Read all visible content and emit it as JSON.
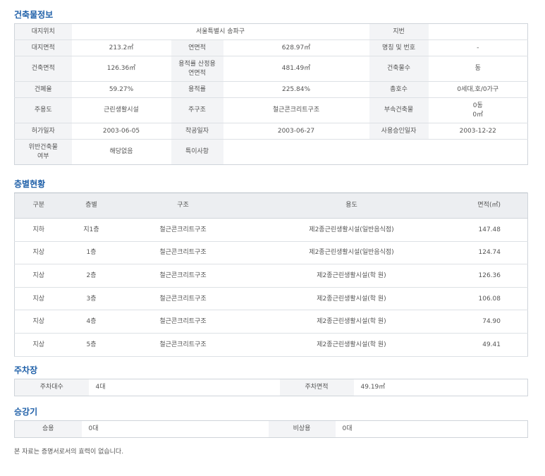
{
  "sections": {
    "building_info": "건축물정보",
    "floors": "층별현황",
    "parking": "주차장",
    "elevator": "승강기"
  },
  "building_info": {
    "rows": [
      [
        {
          "text": "대지위치",
          "type": "label"
        },
        {
          "text": "서울특별시 송파구",
          "type": "value",
          "colspan": 3
        },
        {
          "text": "지번",
          "type": "label"
        },
        {
          "text": "",
          "type": "value"
        }
      ],
      [
        {
          "text": "대지면적",
          "type": "label"
        },
        {
          "text": "213.2㎡",
          "type": "value"
        },
        {
          "text": "연면적",
          "type": "label"
        },
        {
          "text": "628.97㎡",
          "type": "value"
        },
        {
          "text": "명칭 및 번호",
          "type": "label"
        },
        {
          "text": "-",
          "type": "value"
        }
      ],
      [
        {
          "text": "건축면적",
          "type": "label"
        },
        {
          "text": "126.36㎡",
          "type": "value"
        },
        {
          "text": "용적률 산정용\n연면적",
          "type": "label"
        },
        {
          "text": "481.49㎡",
          "type": "value"
        },
        {
          "text": "건축물수",
          "type": "label"
        },
        {
          "text": "동",
          "type": "value"
        }
      ],
      [
        {
          "text": "건폐율",
          "type": "label"
        },
        {
          "text": "59.27%",
          "type": "value"
        },
        {
          "text": "용적률",
          "type": "label"
        },
        {
          "text": "225.84%",
          "type": "value"
        },
        {
          "text": "총호수",
          "type": "label"
        },
        {
          "text": "0세대,호/0가구",
          "type": "value"
        }
      ],
      [
        {
          "text": "주용도",
          "type": "label"
        },
        {
          "text": "근린생활시설",
          "type": "value"
        },
        {
          "text": "주구조",
          "type": "label"
        },
        {
          "text": "철근콘크리트구조",
          "type": "value"
        },
        {
          "text": "부속건축물",
          "type": "label"
        },
        {
          "text": "0동\n0㎡",
          "type": "value"
        }
      ],
      [
        {
          "text": "허가일자",
          "type": "label"
        },
        {
          "text": "2003-06-05",
          "type": "value"
        },
        {
          "text": "착공일자",
          "type": "label"
        },
        {
          "text": "2003-06-27",
          "type": "value"
        },
        {
          "text": "사용승인일자",
          "type": "label"
        },
        {
          "text": "2003-12-22",
          "type": "value"
        }
      ],
      [
        {
          "text": "위반건축물\n여부",
          "type": "label"
        },
        {
          "text": "해당없음",
          "type": "value"
        },
        {
          "text": "특이사항",
          "type": "label"
        },
        {
          "text": "",
          "type": "value",
          "colspan": 3
        }
      ]
    ]
  },
  "floors": {
    "headers": [
      "구분",
      "층별",
      "구조",
      "용도",
      "면적(㎡)"
    ],
    "rows": [
      [
        "지하",
        "지1층",
        "철근콘크리트구조",
        "제2종근린생활시설(일반음식점)",
        "147.48"
      ],
      [
        "지상",
        "1층",
        "철근콘크리트구조",
        "제2종근린생활시설(일반음식점)",
        "124.74"
      ],
      [
        "지상",
        "2층",
        "철근콘크리트구조",
        "제2종근린생활시설(학 원)",
        "126.36"
      ],
      [
        "지상",
        "3층",
        "철근콘크리트구조",
        "제2종근린생활시설(학 원)",
        "106.08"
      ],
      [
        "지상",
        "4층",
        "철근콘크리트구조",
        "제2종근린생활시설(학 원)",
        "74.90"
      ],
      [
        "지상",
        "5층",
        "철근콘크리트구조",
        "제2종근린생활시설(학 원)",
        "49.41"
      ]
    ]
  },
  "parking": {
    "count_label": "주차대수",
    "count_value": "4대",
    "area_label": "주차면적",
    "area_value": "49.19㎡"
  },
  "elevator": {
    "passenger_label": "승용",
    "passenger_value": "0대",
    "emergency_label": "비상용",
    "emergency_value": "0대"
  },
  "notice": "본 자료는 증명서로서의 효력이 없습니다.",
  "colors": {
    "title": "#1e5fa8",
    "label_bg": "#f3f4f6",
    "header_bg": "#eceef1",
    "border": "#cfd4da"
  }
}
